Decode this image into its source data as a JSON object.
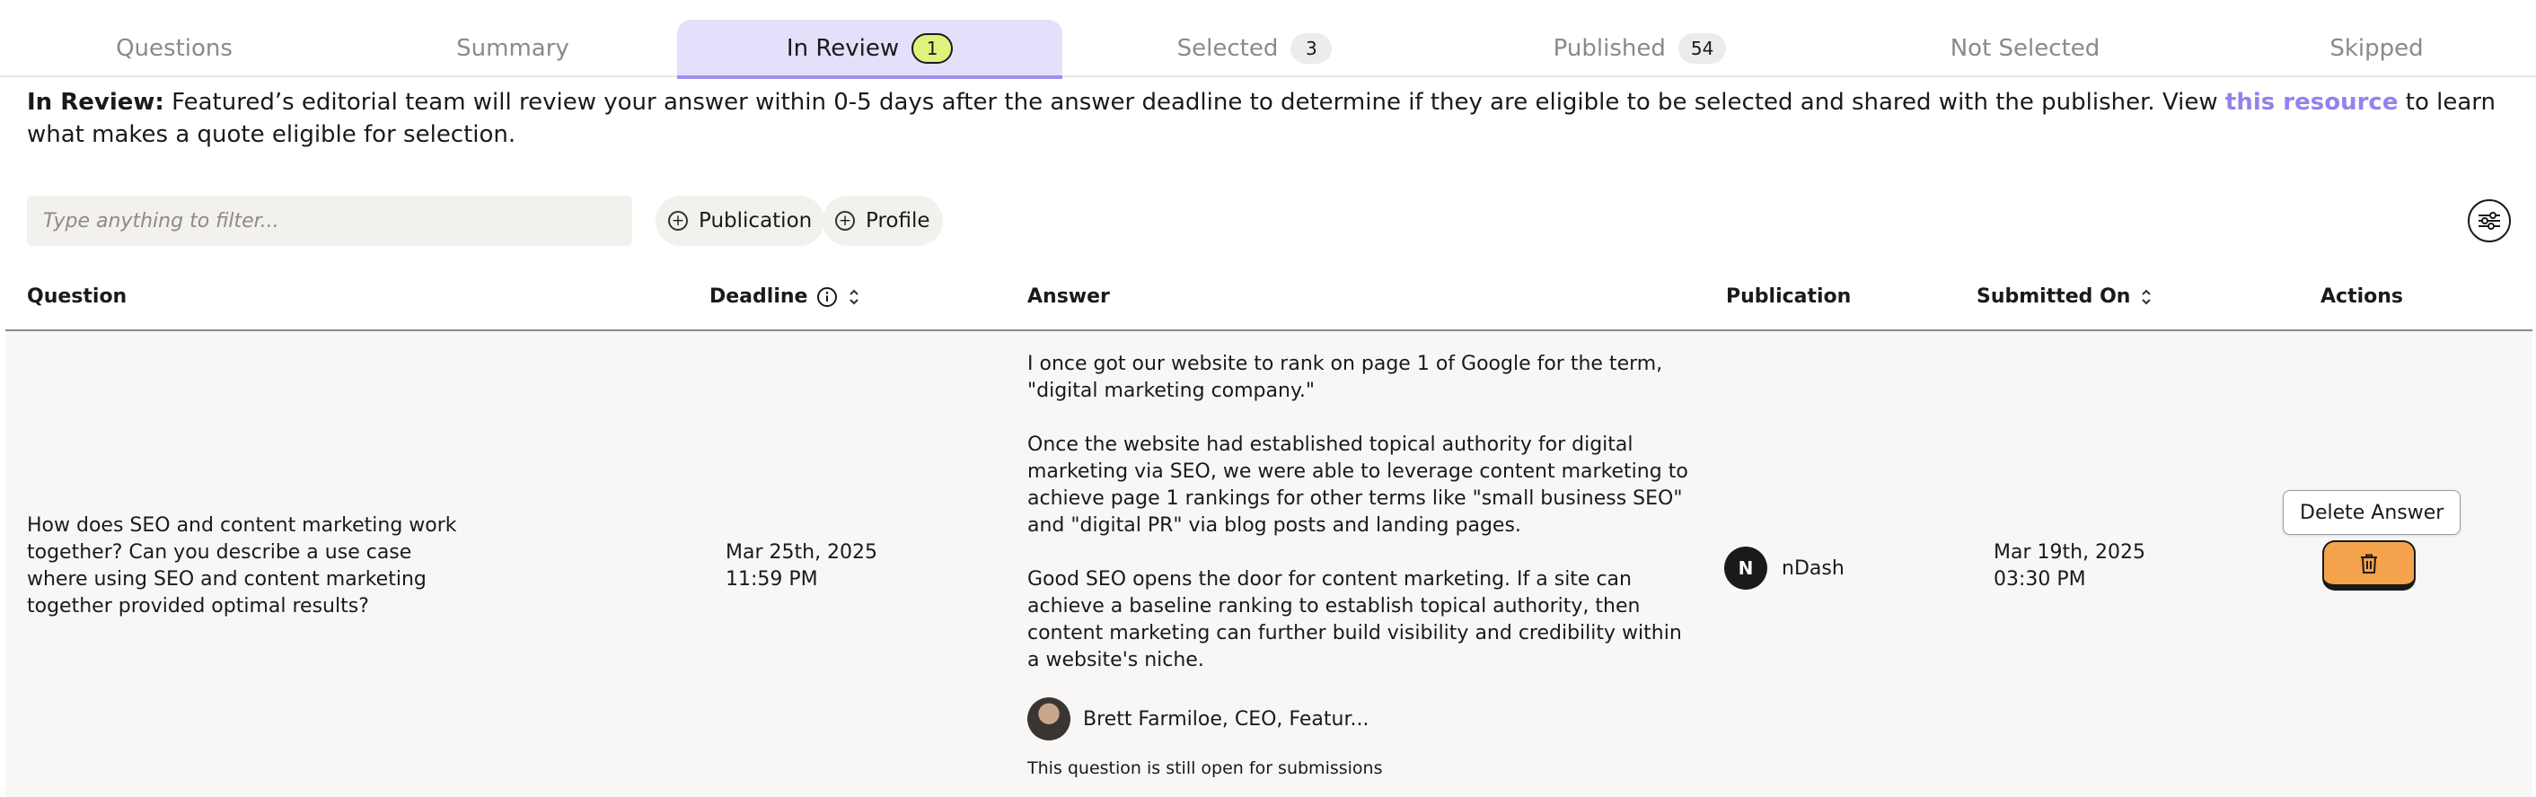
{
  "tabs": [
    {
      "label": "Questions",
      "badge": null
    },
    {
      "label": "Summary",
      "badge": null
    },
    {
      "label": "In Review",
      "badge": "1"
    },
    {
      "label": "Selected",
      "badge": "3"
    },
    {
      "label": "Published",
      "badge": "54"
    },
    {
      "label": "Not Selected",
      "badge": null
    },
    {
      "label": "Skipped",
      "badge": null
    }
  ],
  "active_tab": "In Review",
  "info": {
    "label": "In Review:",
    "text_before": "Featured’s editorial team will review your answer within 0-5 days after the answer deadline to determine if they are eligible to be selected and shared with the publisher. View",
    "link": "this resource",
    "text_after": "to learn what makes a quote eligible for selection."
  },
  "filter": {
    "placeholder": "Type anything to filter...",
    "chips": [
      "Publication",
      "Profile"
    ]
  },
  "table": {
    "headers": {
      "question": "Question",
      "deadline": "Deadline",
      "answer": "Answer",
      "publication": "Publication",
      "submitted": "Submitted On",
      "actions": "Actions"
    },
    "rows": [
      {
        "question": "How does SEO and content marketing work together? Can you describe a use case where using SEO and content marketing together provided optimal results?",
        "deadline_date": "Mar 25th, 2025",
        "deadline_time": "11:59 PM",
        "answer_paragraphs": [
          "I once got our website to rank on page 1 of Google for the term, \"digital marketing company.\"",
          "Once the website had established topical authority for digital marketing via SEO, we were able to leverage content marketing to achieve page 1 rankings for other terms like \"small business SEO\" and \"digital PR\" via blog posts and landing pages.",
          "Good SEO opens the door for content marketing. If a site can achieve a baseline ranking to establish topical authority, then content marketing can further build visibility and credibility within a website's niche."
        ],
        "author": "Brett Farmiloe, CEO, Featur...",
        "status_note": "This question is still open for submissions",
        "publication_initial": "N",
        "publication": "nDash",
        "submitted_date": "Mar 19th, 2025",
        "submitted_time": "03:30 PM",
        "action_tooltip": "Delete Answer"
      }
    ]
  },
  "colors": {
    "active_tab_bg": "#e3e0fb",
    "active_tab_underline": "#9d8ff0",
    "active_badge": "#dff27c",
    "link": "#9580f0",
    "delete_button": "#f4a24b",
    "row_bg": "#f8f7f5"
  },
  "icons": {
    "chip": "plus-circle-icon",
    "settings": "sliders-icon",
    "deadline_info": "info-circle-icon",
    "sort": "sort-arrows-icon",
    "delete": "trash-icon"
  }
}
